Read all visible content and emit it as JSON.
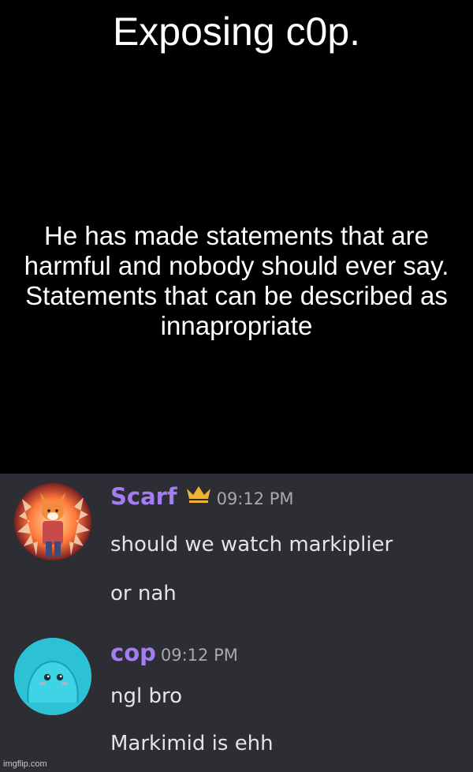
{
  "meme": {
    "title": "Exposing c0p.",
    "body": "He has made statements that are harmful and nobody should ever say. Statements that can be described as innapropriate"
  },
  "chat": {
    "messages": [
      {
        "username": "Scarf",
        "timestamp": "09:12 PM",
        "badge_icon": "crown-icon",
        "lines": [
          "should we watch markiplier",
          "or nah"
        ]
      },
      {
        "username": "cop",
        "timestamp": "09:12 PM",
        "lines": [
          "ngl bro",
          "Markimid is ehh"
        ]
      }
    ]
  },
  "watermark": "imgflip.com",
  "colors": {
    "username": "#a57df2",
    "crown": "#f0b232",
    "chat_background": "#2c2e33",
    "message_text": "#e3e4e7",
    "timestamp": "#a7a9ae",
    "cop_avatar": "#2dc1d6"
  }
}
